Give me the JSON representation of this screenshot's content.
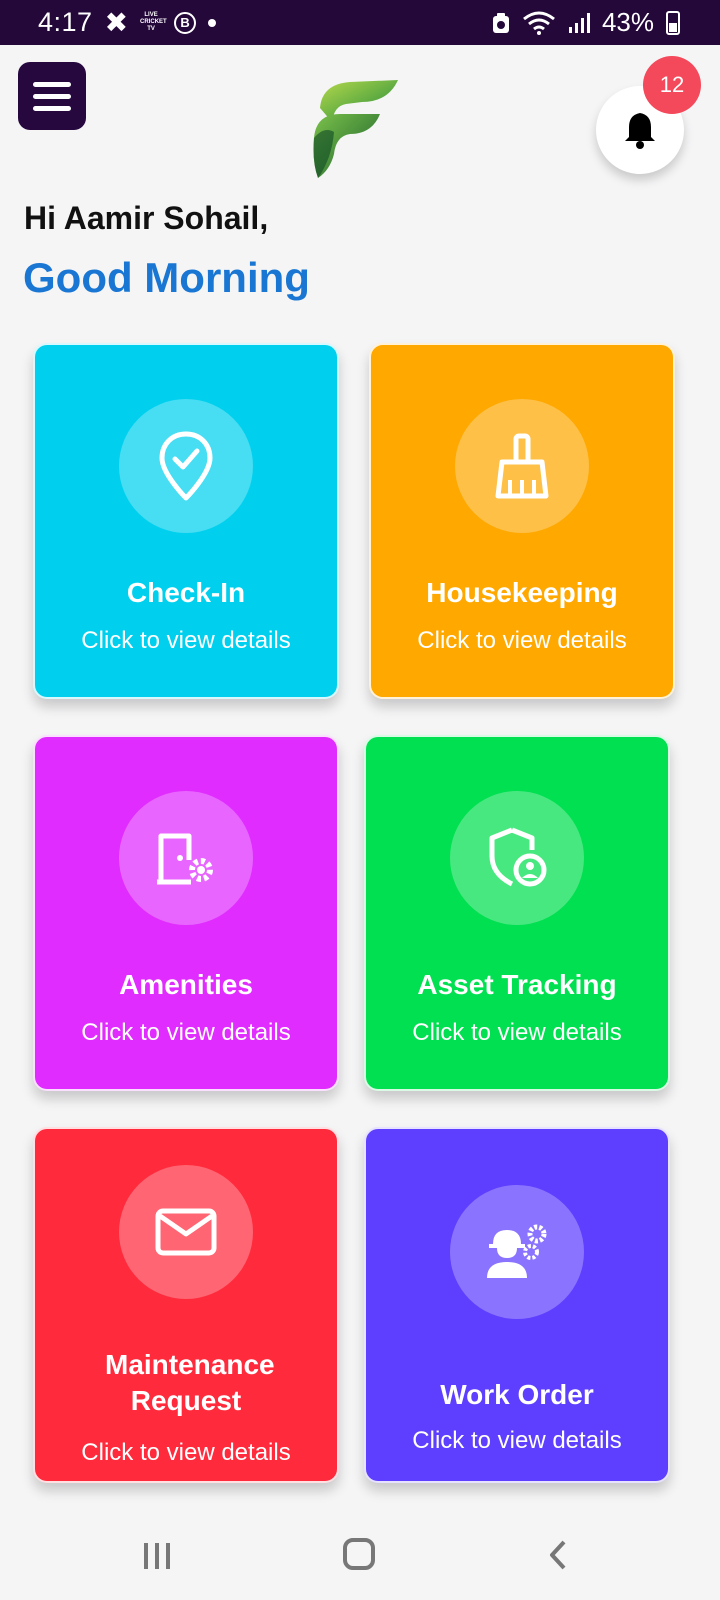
{
  "status_bar": {
    "time": "4:17",
    "livetv": "LIVE CRICKET TV",
    "b_icon": "B",
    "battery": "43%"
  },
  "header": {
    "notification_count": "12"
  },
  "greeting": {
    "name": "Hi Aamir Sohail,",
    "time_of_day": "Good Morning"
  },
  "cards": [
    {
      "title": "Check-In",
      "subtitle": "Click to view details",
      "color": "#00d0ee",
      "icon": "location-check-icon"
    },
    {
      "title": "Housekeeping",
      "subtitle": "Click to view details",
      "color": "#ffa800",
      "icon": "broom-icon"
    },
    {
      "title": "Amenities",
      "subtitle": "Click to view details",
      "color": "#e02cff",
      "icon": "door-gear-icon"
    },
    {
      "title": "Asset Tracking",
      "subtitle": "Click to view details",
      "color": "#00e050",
      "icon": "shield-user-icon"
    },
    {
      "title": "Maintenance Request",
      "subtitle": "Click to view details",
      "color": "#ff2a3c",
      "icon": "envelope-icon"
    },
    {
      "title": "Work Order",
      "subtitle": "Click to view details",
      "color": "#5e3fff",
      "icon": "worker-gears-icon"
    }
  ],
  "colors": {
    "accent_blue": "#1976d2",
    "header_dark": "#26083f",
    "badge_red": "#f4495a"
  }
}
